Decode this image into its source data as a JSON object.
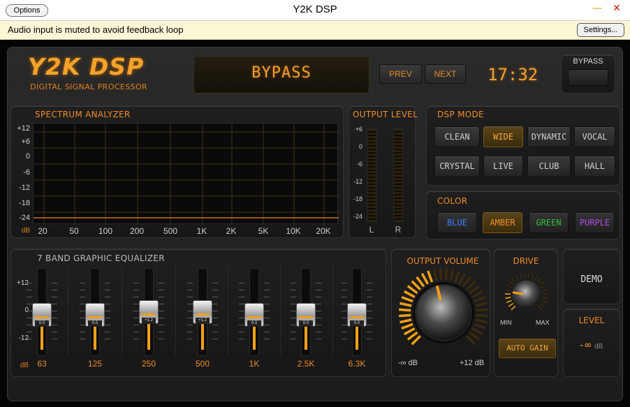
{
  "window": {
    "title": "Y2K DSP",
    "options_label": "Options",
    "minimize_glyph": "—",
    "close_glyph": "✕"
  },
  "notice": {
    "text": "Audio input is muted to avoid feedback loop",
    "settings_label": "Settings..."
  },
  "brand": {
    "logo": "Y2K DSP",
    "subtitle": "DIGITAL SIGNAL PROCESSOR"
  },
  "display": {
    "text": "BYPASS",
    "prev_label": "PREV",
    "next_label": "NEXT",
    "clock": "17:32"
  },
  "bypass": {
    "label": "BYPASS"
  },
  "spectrum": {
    "title": "SPECTRUM ANALYZER",
    "y_labels": [
      "+12",
      "+6",
      "0",
      "-6",
      "-12",
      "-18",
      "-24",
      "dB"
    ],
    "x_labels": [
      "20",
      "50",
      "100",
      "200",
      "500",
      "1K",
      "2K",
      "5K",
      "10K",
      "20K"
    ]
  },
  "output_level": {
    "title": "OUTPUT LEVEL",
    "scale": [
      "+6",
      "0",
      "-6",
      "-12",
      "-18",
      "-24"
    ],
    "left": "L",
    "right": "R"
  },
  "dsp_mode": {
    "title": "DSP MODE",
    "modes": [
      "CLEAN",
      "WIDE",
      "DYNAMIC",
      "VOCAL",
      "CRYSTAL",
      "LIVE",
      "CLUB",
      "HALL"
    ],
    "selected": "WIDE"
  },
  "color": {
    "title": "COLOR",
    "options": [
      {
        "label": "BLUE",
        "color": "#3f7dff"
      },
      {
        "label": "AMBER",
        "color": "#f08c28"
      },
      {
        "label": "GREEN",
        "color": "#2fbf3a"
      },
      {
        "label": "PURPLE",
        "color": "#b14be0"
      }
    ],
    "selected": "AMBER"
  },
  "eq": {
    "title": "7 BAND GRAPHIC EQUALIZER",
    "scale": [
      "+12",
      "0",
      "-12",
      "dB"
    ],
    "bands": [
      {
        "label": "63",
        "value": "0.0",
        "gain": 0
      },
      {
        "label": "125",
        "value": "0.0",
        "gain": 0
      },
      {
        "label": "250",
        "value": "+1.2",
        "gain": 1.2
      },
      {
        "label": "500",
        "value": "+1.2",
        "gain": 1.2
      },
      {
        "label": "1K",
        "value": "0.0",
        "gain": 0
      },
      {
        "label": "2.5K",
        "value": "0.0",
        "gain": 0
      },
      {
        "label": "6.3K",
        "value": "0.0",
        "gain": 0
      }
    ]
  },
  "volume": {
    "title": "OUTPUT VOLUME",
    "min": "-∞ dB",
    "max": "+12 dB",
    "level": 0.45
  },
  "drive": {
    "title": "DRIVE",
    "min": "MIN",
    "max": "MAX",
    "auto_gain": "AUTO GAIN",
    "level": 0.2
  },
  "demo": {
    "label": "DEMO"
  },
  "level": {
    "title": "LEVEL",
    "value": "-∞",
    "unit": "dB"
  },
  "theme": {
    "accent": "#f08c28"
  }
}
